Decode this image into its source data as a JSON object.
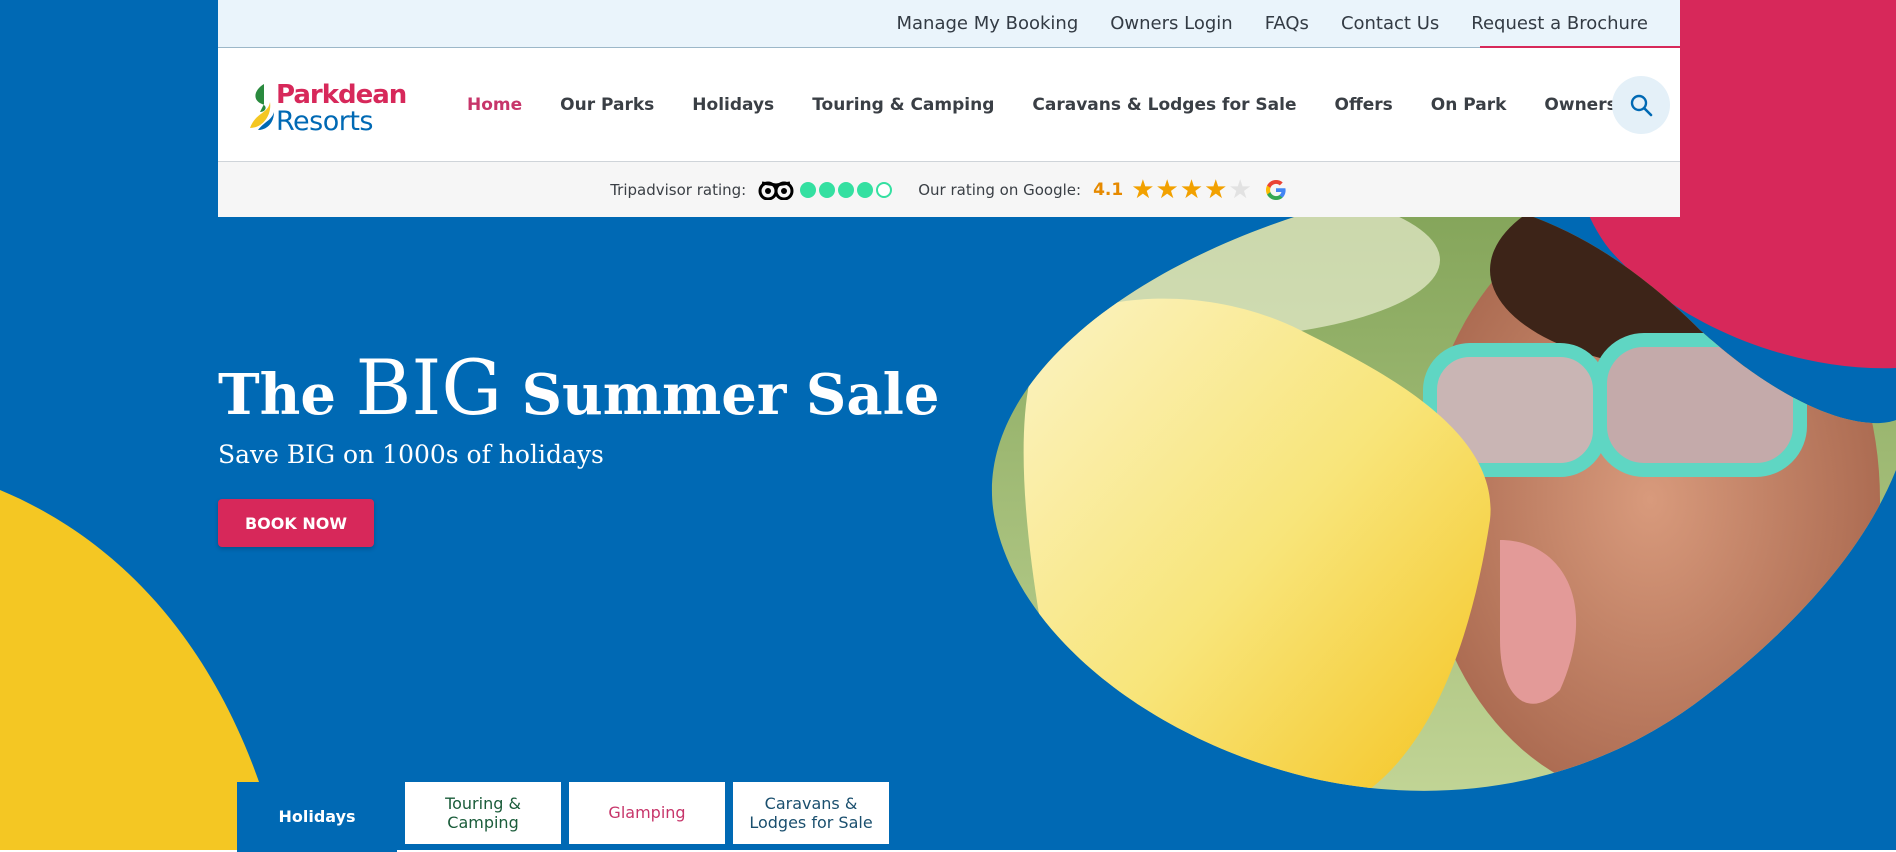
{
  "utility_nav": {
    "links": [
      "Manage My Booking",
      "Owners Login",
      "FAQs",
      "Contact Us",
      "Request a Brochure"
    ]
  },
  "logo": {
    "line1": "Parkdean",
    "line2": "Resorts"
  },
  "main_nav": {
    "items": [
      "Home",
      "Our Parks",
      "Holidays",
      "Touring & Camping",
      "Caravans & Lodges for Sale",
      "Offers",
      "On Park",
      "Owners Area"
    ],
    "active": "Home"
  },
  "ratings": {
    "tripadvisor_label": "Tripadvisor rating:",
    "tripadvisor_bubbles": 4,
    "tripadvisor_bubbles_max": 5,
    "google_label": "Our rating on Google:",
    "google_score": "4.1",
    "google_stars": 4,
    "google_stars_max": 5
  },
  "hero": {
    "title_part1": "The",
    "title_big": "BIG",
    "title_part2": "Summer Sale",
    "subtitle": "Save BIG on 1000s of holidays",
    "cta_label": "BOOK NOW"
  },
  "tabs": {
    "items": [
      "Holidays",
      "Touring & Camping",
      "Glamping",
      "Caravans & Lodges for Sale"
    ],
    "active": "Holidays"
  },
  "colors": {
    "brand_blue": "#0069b4",
    "brand_pink": "#d7285a",
    "brand_yellow": "#f4c723",
    "tripadvisor_green": "#34e0a1",
    "star_gold": "#f2a100"
  }
}
